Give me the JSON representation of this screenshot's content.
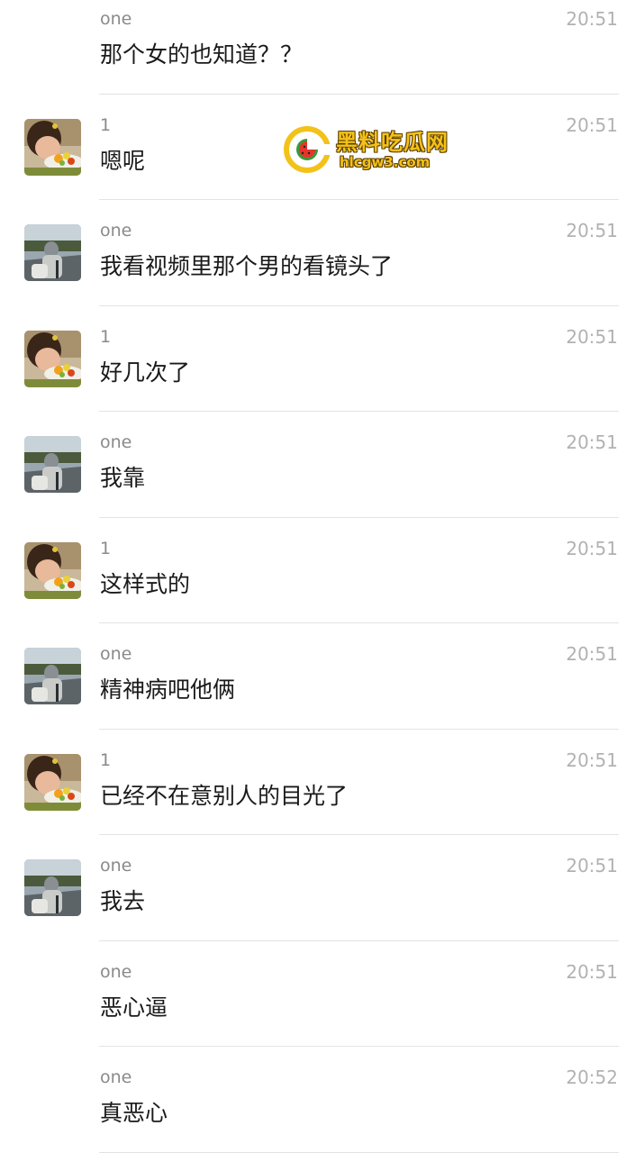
{
  "messages": [
    {
      "sender": "one",
      "time": "20:51",
      "text": "那个女的也知道？？",
      "avatar": "none"
    },
    {
      "sender": "1",
      "time": "20:51",
      "text": "嗯呢",
      "avatar": "girl-with-food-photo"
    },
    {
      "sender": "one",
      "time": "20:51",
      "text": "我看视频里那个男的看镜头了",
      "avatar": "road-photo"
    },
    {
      "sender": "1",
      "time": "20:51",
      "text": "好几次了",
      "avatar": "girl-with-food-photo"
    },
    {
      "sender": "one",
      "time": "20:51",
      "text": "我靠",
      "avatar": "road-photo"
    },
    {
      "sender": "1",
      "time": "20:51",
      "text": "这样式的",
      "avatar": "girl-with-food-photo"
    },
    {
      "sender": "one",
      "time": "20:51",
      "text": "精神病吧他俩",
      "avatar": "road-photo"
    },
    {
      "sender": "1",
      "time": "20:51",
      "text": "已经不在意别人的目光了",
      "avatar": "girl-with-food-photo"
    },
    {
      "sender": "one",
      "time": "20:51",
      "text": "我去",
      "avatar": "road-photo"
    },
    {
      "sender": "one",
      "time": "20:51",
      "text": "恶心逼",
      "avatar": "none"
    },
    {
      "sender": "one",
      "time": "20:52",
      "text": "真恶心",
      "avatar": "none"
    }
  ],
  "watermark": {
    "title": "黑料吃瓜网",
    "url": "hlcgw3.com",
    "color": "#f3c21a"
  }
}
